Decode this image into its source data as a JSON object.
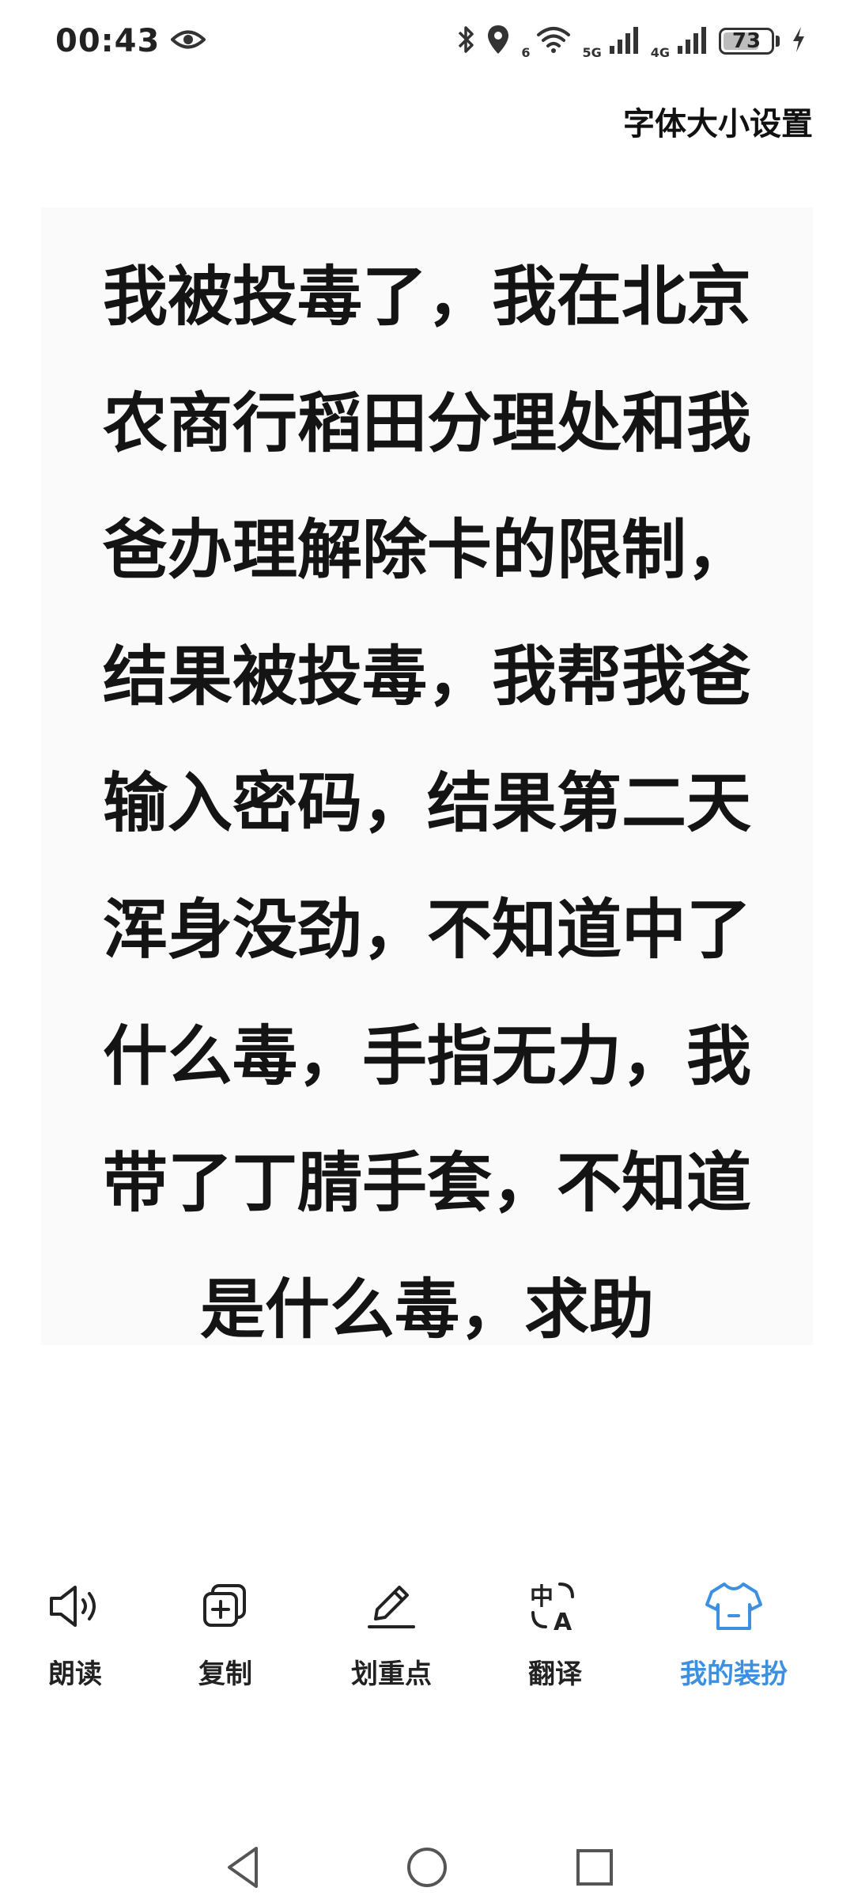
{
  "status_bar": {
    "time": "00:43",
    "network_6": "6",
    "network_5g": "5G",
    "network_4g": "4G",
    "battery_level": "73",
    "icons": [
      "eye-icon",
      "bluetooth-icon",
      "location-icon",
      "wifi-icon",
      "signal-icon",
      "signal-icon",
      "battery-icon",
      "charging-icon"
    ]
  },
  "header": {
    "font_size_setting": "字体大小设置"
  },
  "content": {
    "text": "我被投毒了，我在北京农商行稻田分理处和我爸办理解除卡的限制，结果被投毒，我帮我爸输入密码，结果第二天浑身没劲，不知道中了什么毒，手指无力，我带了丁腈手套，不知道是什么毒，求助"
  },
  "toolbar": {
    "items": [
      {
        "label": "朗读",
        "icon": "speaker-icon"
      },
      {
        "label": "复制",
        "icon": "copy-icon"
      },
      {
        "label": "划重点",
        "icon": "pencil-icon"
      },
      {
        "label": "翻译",
        "icon": "translate-icon"
      },
      {
        "label": "我的装扮",
        "icon": "shirt-icon",
        "active": true
      }
    ],
    "active_color": "#3d8fe0"
  },
  "nav_bar": {
    "icons": [
      "back-icon",
      "home-icon",
      "recents-icon"
    ]
  }
}
